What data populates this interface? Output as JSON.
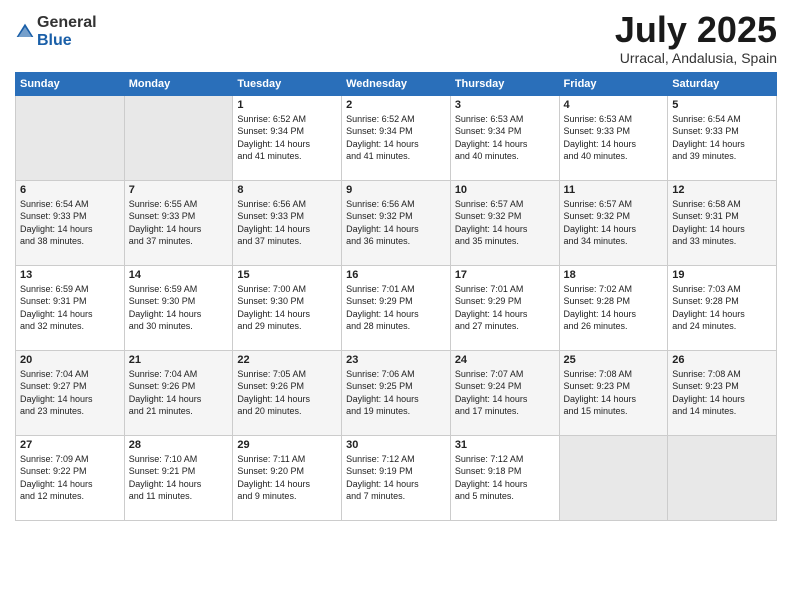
{
  "header": {
    "logo_general": "General",
    "logo_blue": "Blue",
    "title": "July 2025",
    "location": "Urracal, Andalusia, Spain"
  },
  "days_of_week": [
    "Sunday",
    "Monday",
    "Tuesday",
    "Wednesday",
    "Thursday",
    "Friday",
    "Saturday"
  ],
  "weeks": [
    {
      "days": [
        {
          "num": "",
          "content": ""
        },
        {
          "num": "",
          "content": ""
        },
        {
          "num": "1",
          "content": "Sunrise: 6:52 AM\nSunset: 9:34 PM\nDaylight: 14 hours\nand 41 minutes."
        },
        {
          "num": "2",
          "content": "Sunrise: 6:52 AM\nSunset: 9:34 PM\nDaylight: 14 hours\nand 41 minutes."
        },
        {
          "num": "3",
          "content": "Sunrise: 6:53 AM\nSunset: 9:34 PM\nDaylight: 14 hours\nand 40 minutes."
        },
        {
          "num": "4",
          "content": "Sunrise: 6:53 AM\nSunset: 9:33 PM\nDaylight: 14 hours\nand 40 minutes."
        },
        {
          "num": "5",
          "content": "Sunrise: 6:54 AM\nSunset: 9:33 PM\nDaylight: 14 hours\nand 39 minutes."
        }
      ]
    },
    {
      "days": [
        {
          "num": "6",
          "content": "Sunrise: 6:54 AM\nSunset: 9:33 PM\nDaylight: 14 hours\nand 38 minutes."
        },
        {
          "num": "7",
          "content": "Sunrise: 6:55 AM\nSunset: 9:33 PM\nDaylight: 14 hours\nand 37 minutes."
        },
        {
          "num": "8",
          "content": "Sunrise: 6:56 AM\nSunset: 9:33 PM\nDaylight: 14 hours\nand 37 minutes."
        },
        {
          "num": "9",
          "content": "Sunrise: 6:56 AM\nSunset: 9:32 PM\nDaylight: 14 hours\nand 36 minutes."
        },
        {
          "num": "10",
          "content": "Sunrise: 6:57 AM\nSunset: 9:32 PM\nDaylight: 14 hours\nand 35 minutes."
        },
        {
          "num": "11",
          "content": "Sunrise: 6:57 AM\nSunset: 9:32 PM\nDaylight: 14 hours\nand 34 minutes."
        },
        {
          "num": "12",
          "content": "Sunrise: 6:58 AM\nSunset: 9:31 PM\nDaylight: 14 hours\nand 33 minutes."
        }
      ]
    },
    {
      "days": [
        {
          "num": "13",
          "content": "Sunrise: 6:59 AM\nSunset: 9:31 PM\nDaylight: 14 hours\nand 32 minutes."
        },
        {
          "num": "14",
          "content": "Sunrise: 6:59 AM\nSunset: 9:30 PM\nDaylight: 14 hours\nand 30 minutes."
        },
        {
          "num": "15",
          "content": "Sunrise: 7:00 AM\nSunset: 9:30 PM\nDaylight: 14 hours\nand 29 minutes."
        },
        {
          "num": "16",
          "content": "Sunrise: 7:01 AM\nSunset: 9:29 PM\nDaylight: 14 hours\nand 28 minutes."
        },
        {
          "num": "17",
          "content": "Sunrise: 7:01 AM\nSunset: 9:29 PM\nDaylight: 14 hours\nand 27 minutes."
        },
        {
          "num": "18",
          "content": "Sunrise: 7:02 AM\nSunset: 9:28 PM\nDaylight: 14 hours\nand 26 minutes."
        },
        {
          "num": "19",
          "content": "Sunrise: 7:03 AM\nSunset: 9:28 PM\nDaylight: 14 hours\nand 24 minutes."
        }
      ]
    },
    {
      "days": [
        {
          "num": "20",
          "content": "Sunrise: 7:04 AM\nSunset: 9:27 PM\nDaylight: 14 hours\nand 23 minutes."
        },
        {
          "num": "21",
          "content": "Sunrise: 7:04 AM\nSunset: 9:26 PM\nDaylight: 14 hours\nand 21 minutes."
        },
        {
          "num": "22",
          "content": "Sunrise: 7:05 AM\nSunset: 9:26 PM\nDaylight: 14 hours\nand 20 minutes."
        },
        {
          "num": "23",
          "content": "Sunrise: 7:06 AM\nSunset: 9:25 PM\nDaylight: 14 hours\nand 19 minutes."
        },
        {
          "num": "24",
          "content": "Sunrise: 7:07 AM\nSunset: 9:24 PM\nDaylight: 14 hours\nand 17 minutes."
        },
        {
          "num": "25",
          "content": "Sunrise: 7:08 AM\nSunset: 9:23 PM\nDaylight: 14 hours\nand 15 minutes."
        },
        {
          "num": "26",
          "content": "Sunrise: 7:08 AM\nSunset: 9:23 PM\nDaylight: 14 hours\nand 14 minutes."
        }
      ]
    },
    {
      "days": [
        {
          "num": "27",
          "content": "Sunrise: 7:09 AM\nSunset: 9:22 PM\nDaylight: 14 hours\nand 12 minutes."
        },
        {
          "num": "28",
          "content": "Sunrise: 7:10 AM\nSunset: 9:21 PM\nDaylight: 14 hours\nand 11 minutes."
        },
        {
          "num": "29",
          "content": "Sunrise: 7:11 AM\nSunset: 9:20 PM\nDaylight: 14 hours\nand 9 minutes."
        },
        {
          "num": "30",
          "content": "Sunrise: 7:12 AM\nSunset: 9:19 PM\nDaylight: 14 hours\nand 7 minutes."
        },
        {
          "num": "31",
          "content": "Sunrise: 7:12 AM\nSunset: 9:18 PM\nDaylight: 14 hours\nand 5 minutes."
        },
        {
          "num": "",
          "content": ""
        },
        {
          "num": "",
          "content": ""
        }
      ]
    }
  ]
}
